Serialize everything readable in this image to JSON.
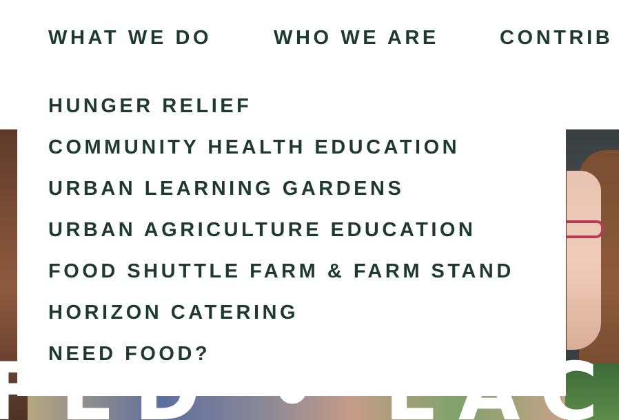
{
  "top_nav": {
    "items": [
      {
        "label": "WHAT WE DO"
      },
      {
        "label": "WHO WE ARE"
      },
      {
        "label": "CONTRIB"
      }
    ]
  },
  "dropdown": {
    "items": [
      {
        "label": "HUNGER RELIEF"
      },
      {
        "label": "COMMUNITY HEALTH EDUCATION"
      },
      {
        "label": "URBAN LEARNING GARDENS"
      },
      {
        "label": "URBAN AGRICULTURE EDUCATION"
      },
      {
        "label": "FOOD SHUTTLE FARM & FARM STAND"
      },
      {
        "label": "HORIZON CATERING"
      },
      {
        "label": "NEED FOOD?"
      }
    ]
  },
  "hero": {
    "headline": "FED • EACH"
  },
  "colors": {
    "nav_text": "#1e3a30",
    "background": "#ffffff"
  }
}
